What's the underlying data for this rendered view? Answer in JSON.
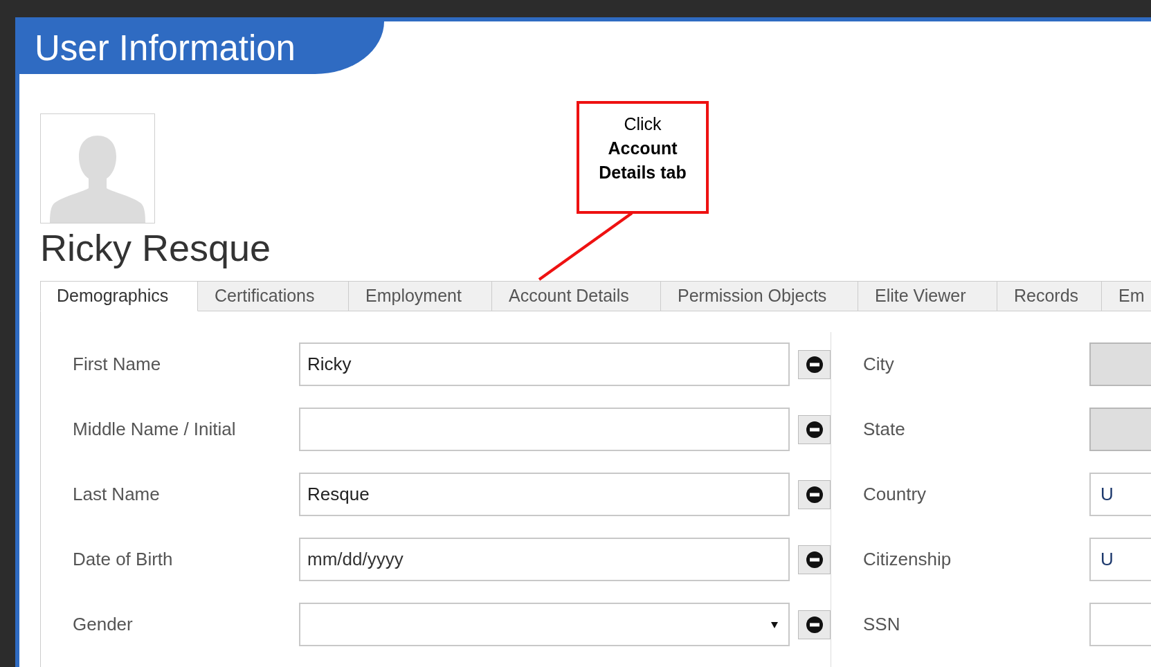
{
  "header": {
    "title": "User Information"
  },
  "profile": {
    "name": "Ricky Resque"
  },
  "callout": {
    "text": "Click **Account Details tab**"
  },
  "tabs": [
    {
      "label": "Demographics",
      "selected": true
    },
    {
      "label": "Certifications",
      "selected": false
    },
    {
      "label": "Employment",
      "selected": false
    },
    {
      "label": "Account Details",
      "selected": false
    },
    {
      "label": "Permission Objects",
      "selected": false
    },
    {
      "label": "Elite Viewer",
      "selected": false
    },
    {
      "label": "Records",
      "selected": false
    },
    {
      "label": "Em",
      "selected": false
    }
  ],
  "left_fields": [
    {
      "label": "First Name",
      "kind": "text",
      "value": "Ricky"
    },
    {
      "label": "Middle Name / Initial",
      "kind": "text"
    },
    {
      "label": "Last Name",
      "kind": "text",
      "value": "Resque"
    },
    {
      "label": "Date of Birth",
      "kind": "text",
      "placeholder": "mm/dd/yyyy"
    },
    {
      "label": "Gender",
      "kind": "select"
    }
  ],
  "right_fields": [
    {
      "label": "City",
      "disabled": true
    },
    {
      "label": "State",
      "disabled": true
    },
    {
      "label": "Country",
      "disabled": false,
      "value": "U"
    },
    {
      "label": "Citizenship",
      "disabled": false,
      "value": "U"
    },
    {
      "label": "SSN",
      "disabled": false
    }
  ]
}
